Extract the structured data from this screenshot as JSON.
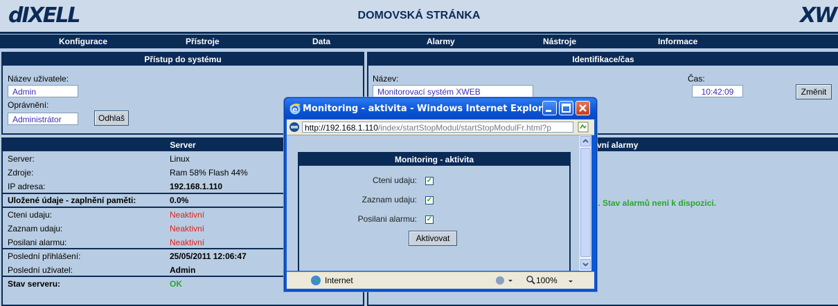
{
  "header": {
    "logo_left": "dIXELL",
    "title": "DOMOVSKÁ STRÁNKA",
    "logo_right": "XW"
  },
  "nav": [
    "Konfigurace",
    "Přístroje",
    "Data",
    "Alarmy",
    "Nástroje",
    "Informace"
  ],
  "access": {
    "title": "Přístup do systému",
    "user_label": "Název uživatele:",
    "user_value": "Admin",
    "perm_label": "Oprávnění:",
    "perm_value": "Administrátor",
    "logout_label": "Odhlaš"
  },
  "ident": {
    "title": "Identifikace/čas",
    "name_label": "Název:",
    "name_value": "Monitorovací systém XWEB",
    "time_label": "Čas:",
    "time_value": "10:42:09",
    "change_label": "Změnit"
  },
  "server": {
    "title": "Server",
    "rows": [
      {
        "label": "Server:",
        "value": "Linux"
      },
      {
        "label": "Zdroje:",
        "value": "Ram 58% Flash 44%"
      },
      {
        "label": "IP adresa:",
        "value": "192.168.1.110"
      },
      {
        "label": "Uložené údaje - zaplnění paměti:",
        "value": "0.0%"
      },
      {
        "label": "Cteni udaju:",
        "value": "Neaktivní"
      },
      {
        "label": "Zaznam udaju:",
        "value": "Neaktivní"
      },
      {
        "label": "Posilani alarmu:",
        "value": "Neaktivní"
      },
      {
        "label": "Poslední přihlášení:",
        "value": "25/05/2011 12:06:47"
      },
      {
        "label": "Poslední uživatel:",
        "value": "Admin"
      },
      {
        "label": "Stav serveru:",
        "value": "OK"
      }
    ]
  },
  "alarms": {
    "title_fragment": "ktivní alarmy",
    "message_fragment": "o. Stav alarmů není k dispozici."
  },
  "colors": {
    "navy": "#0b2b57",
    "panel_bg": "#b8cde3",
    "inactive": "#e0201a",
    "ok": "#2ba52b"
  },
  "popup": {
    "window_title": "Monitoring - aktivita - Windows Internet Explorer",
    "url_host": "http://192.168.1.110",
    "url_path": "/index/startStopModul/startStopModulFr.html?p",
    "panel_title": "Monitoring - aktivita",
    "options": [
      {
        "label": "Cteni udaju:",
        "checked": true
      },
      {
        "label": "Zaznam udaju:",
        "checked": true
      },
      {
        "label": "Posilani alarmu:",
        "checked": true
      }
    ],
    "activate_label": "Aktivovat",
    "status_zone": "Internet",
    "zoom": "100%"
  }
}
